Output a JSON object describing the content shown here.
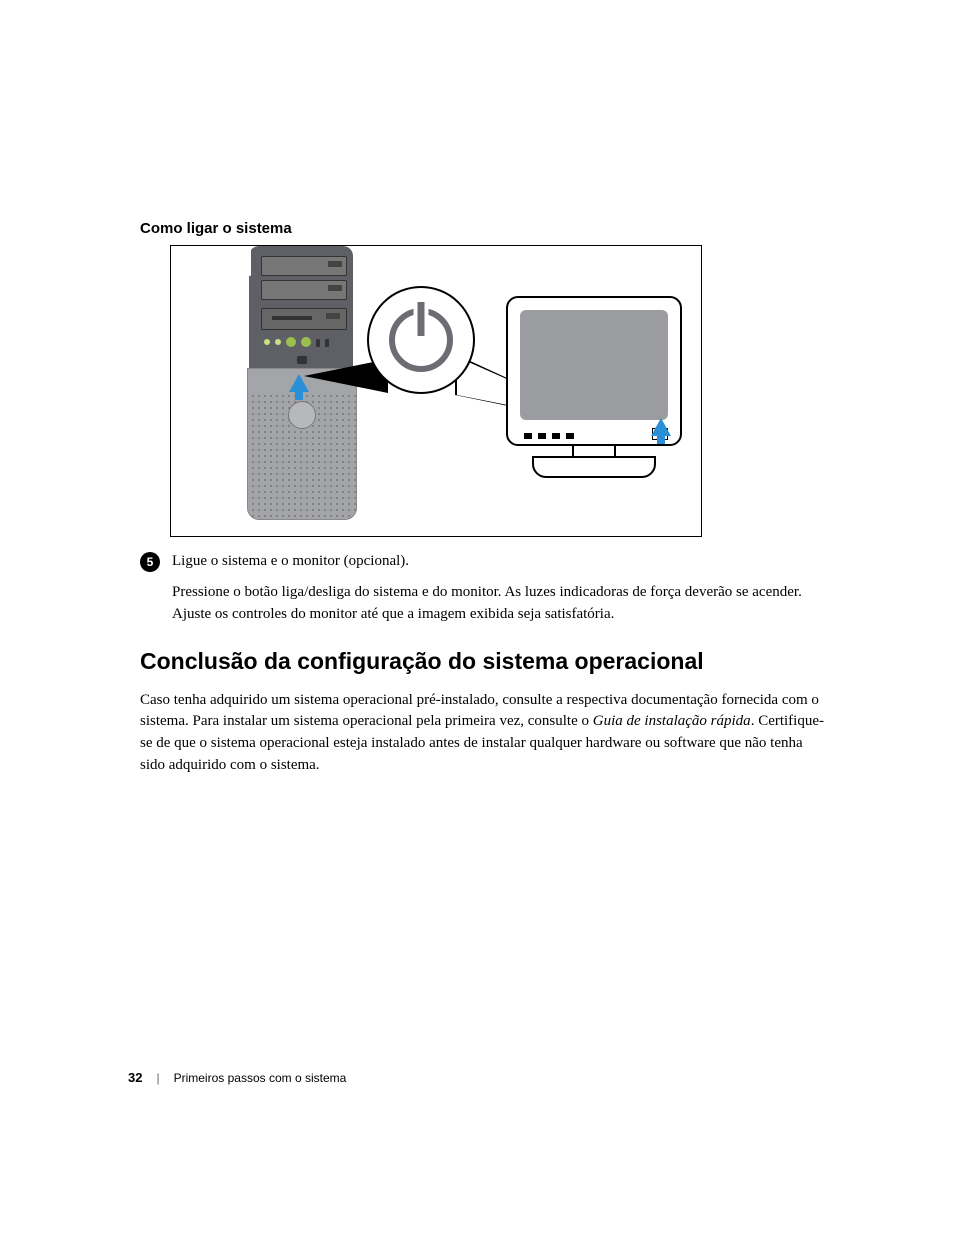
{
  "section_heading": "Como ligar o sistema",
  "step": {
    "number": "5",
    "lead": "Ligue o sistema e o monitor (opcional).",
    "body": "Pressione o botão liga/desliga do sistema e do monitor. As luzes indicadoras de força deverão se acender. Ajuste os controles do monitor até que a imagem exibida seja satisfatória."
  },
  "heading2": "Conclusão da configuração do sistema operacional",
  "para_parts": {
    "p1": "Caso tenha adquirido um sistema operacional pré-instalado, consulte a respectiva documentação fornecida com o sistema. Para instalar um sistema operacional pela primeira vez, consulte o ",
    "em": "Guia de instalação rápida",
    "p2": ". Certifique-se de que o sistema operacional esteja instalado antes de instalar qualquer hardware ou software que não tenha sido adquirido com o sistema."
  },
  "footer": {
    "page": "32",
    "title": "Primeiros passos com o sistema"
  }
}
